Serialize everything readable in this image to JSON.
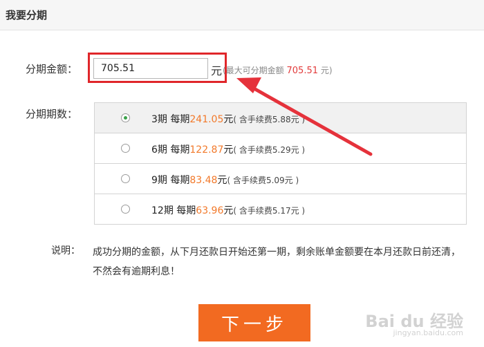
{
  "header": {
    "title": "我要分期"
  },
  "amount": {
    "label": "分期金额：",
    "value": "705.51",
    "unit": "元",
    "note_prefix": "(最大可分期金额 ",
    "note_amount": "705.51",
    "note_suffix": " 元)"
  },
  "plans": {
    "label": "分期期数：",
    "rows": [
      {
        "period": "3期",
        "each_label": "每期",
        "amount": "241.05",
        "unit": "元",
        "fee": "( 含手续费5.88元 )",
        "selected": true
      },
      {
        "period": "6期",
        "each_label": "每期",
        "amount": "122.87",
        "unit": "元",
        "fee": "( 含手续费5.29元 )",
        "selected": false
      },
      {
        "period": "9期",
        "each_label": "每期",
        "amount": "83.48",
        "unit": "元",
        "fee": "( 含手续费5.09元 )",
        "selected": false
      },
      {
        "period": "12期",
        "each_label": "每期",
        "amount": "63.96",
        "unit": "元",
        "fee": "( 含手续费5.17元 )",
        "selected": false
      }
    ]
  },
  "note": {
    "label": "说明：",
    "text": "成功分期的金额，从下月还款日开始还第一期，剩余账单金额要在本月还款日前还清，不然会有逾期利息！"
  },
  "next_button": {
    "label": "下一步"
  },
  "watermark": {
    "brand": "Bai du 经验",
    "site": "jingyan.baidu.com"
  },
  "colors": {
    "accent": "#f26a21",
    "highlight": "#e0262a",
    "amount_red": "#e23b3b",
    "pay_orange": "#f2792a"
  }
}
